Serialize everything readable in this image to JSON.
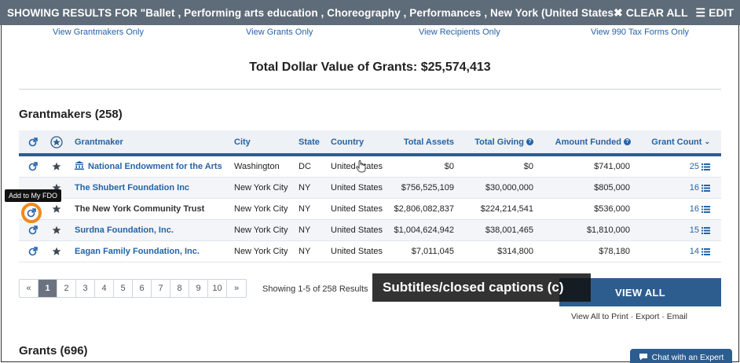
{
  "topbar": {
    "results_text": "SHOWING RESULTS FOR \"Ballet , Performing arts education , Choreography , Performances , New York (United States), ...",
    "clear_all": "CLEAR ALL",
    "edit": "EDIT"
  },
  "view_links": [
    "View Grantmakers Only",
    "View Grants Only",
    "View Recipients Only",
    "View 990 Tax Forms Only"
  ],
  "total": "Total Dollar Value of Grants: $25,574,413",
  "grantmakers_heading": "Grantmakers (258)",
  "columns": {
    "grantmaker": "Grantmaker",
    "city": "City",
    "state": "State",
    "country": "Country",
    "total_assets": "Total Assets",
    "total_giving": "Total Giving",
    "amount_funded": "Amount Funded",
    "grant_count": "Grant Count"
  },
  "rows": [
    {
      "name": "National Endowment for the Arts",
      "city": "Washington",
      "state": "DC",
      "country": "United States",
      "assets": "$0",
      "giving": "$0",
      "funded": "$741,000",
      "count": "25"
    },
    {
      "name": "The Shubert Foundation Inc",
      "city": "New York City",
      "state": "NY",
      "country": "United States",
      "assets": "$756,525,109",
      "giving": "$30,000,000",
      "funded": "$805,000",
      "count": "16"
    },
    {
      "name": "The New York Community Trust",
      "city": "New York City",
      "state": "NY",
      "country": "United States",
      "assets": "$2,806,082,837",
      "giving": "$224,214,541",
      "funded": "$536,000",
      "count": "16"
    },
    {
      "name": "Surdna Foundation, Inc.",
      "city": "New York City",
      "state": "NY",
      "country": "United States",
      "assets": "$1,004,624,942",
      "giving": "$38,001,465",
      "funded": "$1,810,000",
      "count": "15"
    },
    {
      "name": "Eagan Family Foundation, Inc.",
      "city": "New York City",
      "state": "NY",
      "country": "United States",
      "assets": "$7,011,045",
      "giving": "$314,800",
      "funded": "$78,180",
      "count": "14"
    }
  ],
  "tooltip": "Add to My FDO",
  "pager": {
    "prev": "«",
    "pages": [
      "1",
      "2",
      "3",
      "4",
      "5",
      "6",
      "7",
      "8",
      "9",
      "10"
    ],
    "next": "»",
    "showing": "Showing 1-5 of 258 Results"
  },
  "caption": "Subtitles/closed captions (c)",
  "view_all": "VIEW ALL",
  "view_all_sub": "View All to Print · Export · Email",
  "grants_heading": "Grants (696)",
  "chat": "Chat with an Expert",
  "colors": {
    "topbar": "#5e6b78",
    "accent": "#2563a8",
    "header_border": "#2d5d8f",
    "ring": "#f08a1c"
  }
}
